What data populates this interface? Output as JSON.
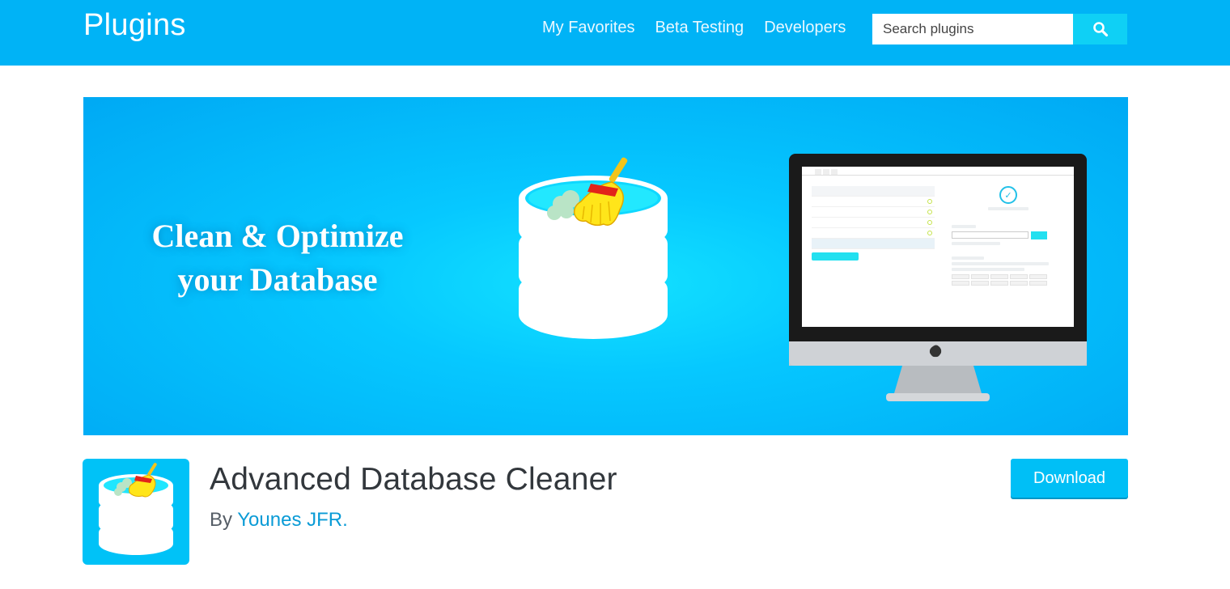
{
  "header": {
    "brand": "Plugins",
    "nav": [
      "My Favorites",
      "Beta Testing",
      "Developers"
    ],
    "search_placeholder": "Search plugins",
    "search_icon": "search-icon"
  },
  "banner": {
    "headline_line1": "Clean & Optimize",
    "headline_line2": "your Database",
    "illustration": "database-with-broom-icon",
    "device": "monitor-with-plugin-screenshot"
  },
  "plugin": {
    "title": "Advanced Database Cleaner",
    "by_prefix": "By",
    "author": "Younes JFR.",
    "download_label": "Download",
    "icon": "database-broom-icon"
  },
  "colors": {
    "header_bg": "#00b3f6",
    "banner_bg": "#06c8ff",
    "accent": "#00bff6",
    "link": "#0a9bd6"
  }
}
